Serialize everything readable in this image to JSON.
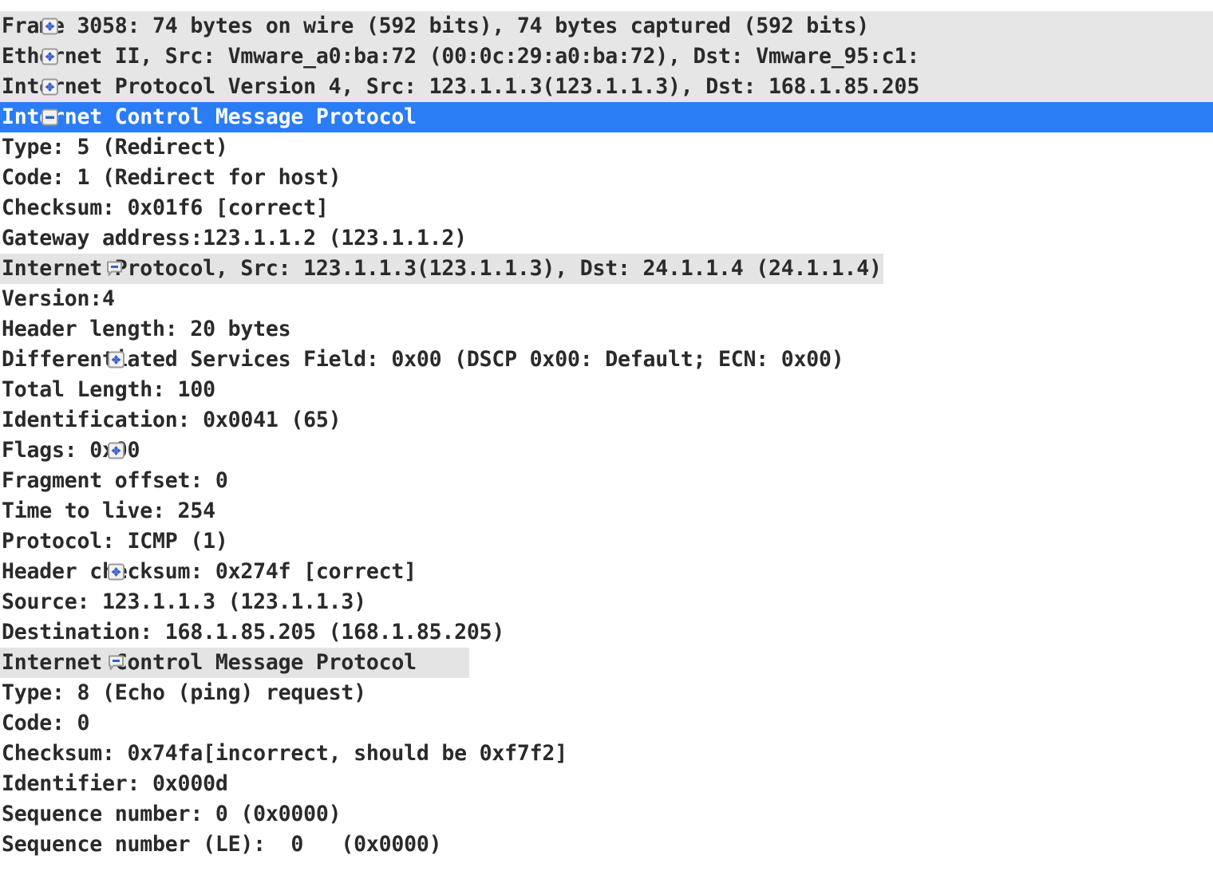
{
  "panel": {
    "name": "packet-details-tree",
    "selection_color": "#2a7df4",
    "row_band_color": "#e4e4e4",
    "text_color": "#2a2a2a"
  },
  "icons": {
    "expand": "plus-box-icon",
    "collapse": "minus-box-icon",
    "collapse_nested": "minus-bubble-icon"
  },
  "rows": [
    {
      "label": "Frame 3058: 74 bytes on wire (592 bits), 74 bytes captured (592 bits)",
      "icon": "plus-box-icon"
    },
    {
      "label": "Ethernet II, Src: Vmware_a0:ba:72 (00:0c:29:a0:ba:72), Dst: Vmware_95:c1:",
      "icon": "plus-box-icon"
    },
    {
      "label": "Internet Protocol Version 4, Src: 123.1.1.3(123.1.1.3), Dst: 168.1.85.205",
      "icon": "plus-box-icon"
    },
    {
      "label": "Internet Control Message Protocol",
      "icon": "minus-box-icon"
    },
    {
      "label": "Type: 5 (Redirect)",
      "icon": ""
    },
    {
      "label": "Code: 1 (Redirect for host)",
      "icon": ""
    },
    {
      "label": "Checksum: 0x01f6 [correct]",
      "icon": ""
    },
    {
      "label": "Gateway address:123.1.1.2 (123.1.1.2)",
      "icon": ""
    },
    {
      "label": "Internet Protocol, Src: 123.1.1.3(123.1.1.3), Dst: 24.1.1.4 (24.1.1.4)",
      "icon": "minus-bubble-icon"
    },
    {
      "label": "Version:4",
      "icon": ""
    },
    {
      "label": "Header length: 20 bytes",
      "icon": ""
    },
    {
      "label": "Differentiated Services Field: 0x00 (DSCP 0x00: Default; ECN: 0x00)",
      "icon": "plus-box-icon"
    },
    {
      "label": "Total Length: 100",
      "icon": ""
    },
    {
      "label": "Identification: 0x0041 (65)",
      "icon": ""
    },
    {
      "label": "Flags: 0x00",
      "icon": "plus-box-icon"
    },
    {
      "label": "Fragment offset: 0",
      "icon": ""
    },
    {
      "label": "Time to live: 254",
      "icon": ""
    },
    {
      "label": "Protocol: ICMP (1)",
      "icon": ""
    },
    {
      "label": "Header checksum: 0x274f [correct]",
      "icon": "plus-box-icon"
    },
    {
      "label": "Source: 123.1.1.3 (123.1.1.3)",
      "icon": ""
    },
    {
      "label": "Destination: 168.1.85.205 (168.1.85.205)",
      "icon": ""
    },
    {
      "label": "Internet Control Message Protocol",
      "icon": "minus-bubble-icon"
    },
    {
      "label": "Type: 8 (Echo (ping) request)",
      "icon": ""
    },
    {
      "label": "Code: 0",
      "icon": ""
    },
    {
      "label": "Checksum: 0x74fa[incorrect, should be 0xf7f2]",
      "icon": ""
    },
    {
      "label": "Identifier: 0x000d",
      "icon": ""
    },
    {
      "label": "Sequence number: 0 (0x0000)",
      "icon": ""
    },
    {
      "label": "Sequence number (LE):  0   (0x0000)",
      "icon": ""
    }
  ]
}
